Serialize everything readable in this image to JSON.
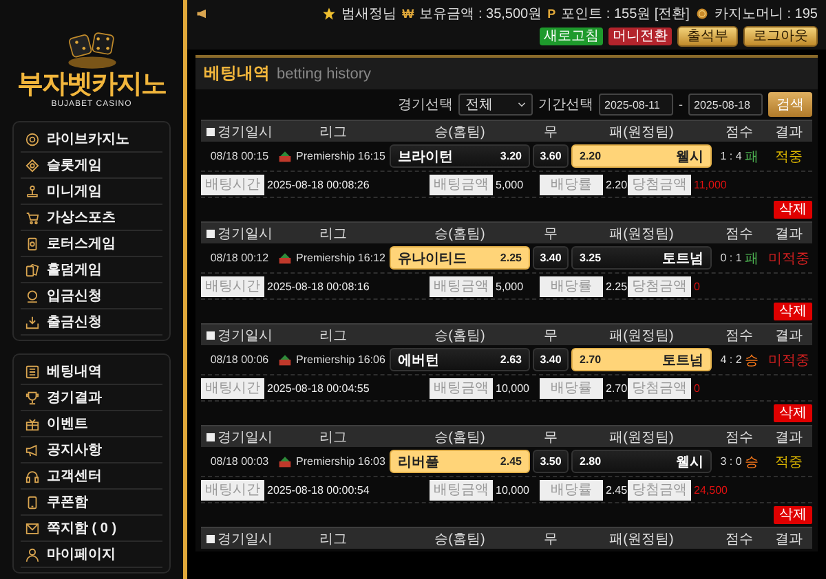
{
  "sidebar": {
    "logo": {
      "title": "부자벳카지노",
      "subtitle": "BUJABET CASINO"
    },
    "groups": [
      {
        "items": [
          "라이브카지노",
          "슬롯게임",
          "미니게임",
          "가상스포츠",
          "로터스게임",
          "홀덤게임",
          "입금신청",
          "출금신청"
        ]
      },
      {
        "items": [
          "베팅내역",
          "경기결과",
          "이벤트",
          "공지사항",
          "고객센터",
          "쿠폰함",
          "쪽지함 ( 0 )",
          "마이페이지"
        ]
      }
    ]
  },
  "topbar": {
    "user": "범새정님",
    "balance_icon": "₩",
    "balance": "보유금액 : 35,500원",
    "points_icon": "P",
    "points": "포인트 : 155원 [전환]",
    "casino_money": "카지노머니 : 195",
    "badges": [
      {
        "label": "새로고침",
        "color": "#1e9a2c"
      },
      {
        "label": "머니전환",
        "color": "#b3242c"
      }
    ],
    "buttons": [
      "출석부",
      "로그아웃"
    ]
  },
  "page": {
    "title": "베팅내역",
    "subtitle": "betting history"
  },
  "filter": {
    "game_label": "경기선택",
    "game_value": "전체",
    "period_label": "기간선택",
    "from": "2025-08-11",
    "separator": "-",
    "to": "2025-08-18",
    "search_button": "검색"
  },
  "bets": [
    {
      "header": {
        "checked": false,
        "columns": [
          "경기일시",
          "리그",
          "승(홈팀)",
          "무",
          "패(원정팀)",
          "점수",
          "결과"
        ]
      },
      "match": {
        "date": "08/18 00:15",
        "league": "Premiership 16:15",
        "home": {
          "team": "브라이턴",
          "odds": "3.20",
          "selected": false
        },
        "draw": {
          "odds": "3.60",
          "selected": false
        },
        "away": {
          "odds": "2.20",
          "team": "웰시",
          "selected": true
        },
        "score": "1 : 4",
        "outcome": {
          "label": "패",
          "kind": "loss"
        },
        "result": {
          "label": "적중",
          "hit": true
        }
      },
      "details": [
        {
          "label": "배팅시간",
          "value": "2025-08-18 00:08:26"
        },
        {
          "label": "배팅금액",
          "value": "5,000"
        },
        {
          "label": "배당률",
          "value": "2.20"
        },
        {
          "label": "당첨금액",
          "value": "11,000"
        }
      ],
      "delete_button": "삭제"
    },
    {
      "header": {
        "checked": false,
        "columns": [
          "경기일시",
          "리그",
          "승(홈팀)",
          "무",
          "패(원정팀)",
          "점수",
          "결과"
        ]
      },
      "match": {
        "date": "08/18 00:12",
        "league": "Premiership 16:12",
        "home": {
          "team": "유나이티드",
          "odds": "2.25",
          "selected": true
        },
        "draw": {
          "odds": "3.40",
          "selected": false
        },
        "away": {
          "odds": "3.25",
          "team": "토트넘",
          "selected": false
        },
        "score": "0 : 1",
        "outcome": {
          "label": "패",
          "kind": "loss"
        },
        "result": {
          "label": "미적중",
          "hit": false
        }
      },
      "details": [
        {
          "label": "배팅시간",
          "value": "2025-08-18 00:08:16"
        },
        {
          "label": "배팅금액",
          "value": "5,000"
        },
        {
          "label": "배당률",
          "value": "2.25"
        },
        {
          "label": "당첨금액",
          "value": "0"
        }
      ],
      "delete_button": "삭제"
    },
    {
      "header": {
        "checked": false,
        "columns": [
          "경기일시",
          "리그",
          "승(홈팀)",
          "무",
          "패(원정팀)",
          "점수",
          "결과"
        ]
      },
      "match": {
        "date": "08/18 00:06",
        "league": "Premiership 16:06",
        "home": {
          "team": "에버턴",
          "odds": "2.63",
          "selected": false
        },
        "draw": {
          "odds": "3.40",
          "selected": false
        },
        "away": {
          "odds": "2.70",
          "team": "토트넘",
          "selected": true
        },
        "score": "4 : 2",
        "outcome": {
          "label": "승",
          "kind": "win"
        },
        "result": {
          "label": "미적중",
          "hit": false
        }
      },
      "details": [
        {
          "label": "배팅시간",
          "value": "2025-08-18 00:04:55"
        },
        {
          "label": "배팅금액",
          "value": "10,000"
        },
        {
          "label": "배당률",
          "value": "2.70"
        },
        {
          "label": "당첨금액",
          "value": "0"
        }
      ],
      "delete_button": "삭제"
    },
    {
      "header": {
        "checked": false,
        "columns": [
          "경기일시",
          "리그",
          "승(홈팀)",
          "무",
          "패(원정팀)",
          "점수",
          "결과"
        ]
      },
      "match": {
        "date": "08/18 00:03",
        "league": "Premiership 16:03",
        "home": {
          "team": "리버풀",
          "odds": "2.45",
          "selected": true
        },
        "draw": {
          "odds": "3.50",
          "selected": false
        },
        "away": {
          "odds": "2.80",
          "team": "웰시",
          "selected": false
        },
        "score": "3 : 0",
        "outcome": {
          "label": "승",
          "kind": "win"
        },
        "result": {
          "label": "적중",
          "hit": true
        }
      },
      "details": [
        {
          "label": "배팅시간",
          "value": "2025-08-18 00:00:54"
        },
        {
          "label": "배팅금액",
          "value": "10,000"
        },
        {
          "label": "배당률",
          "value": "2.45"
        },
        {
          "label": "당첨금액",
          "value": "24,500"
        }
      ],
      "delete_button": "삭제"
    },
    {
      "header": {
        "checked": false,
        "columns": [
          "경기일시",
          "리그",
          "승(홈팀)",
          "무",
          "패(원정팀)",
          "점수",
          "결과"
        ]
      }
    }
  ]
}
